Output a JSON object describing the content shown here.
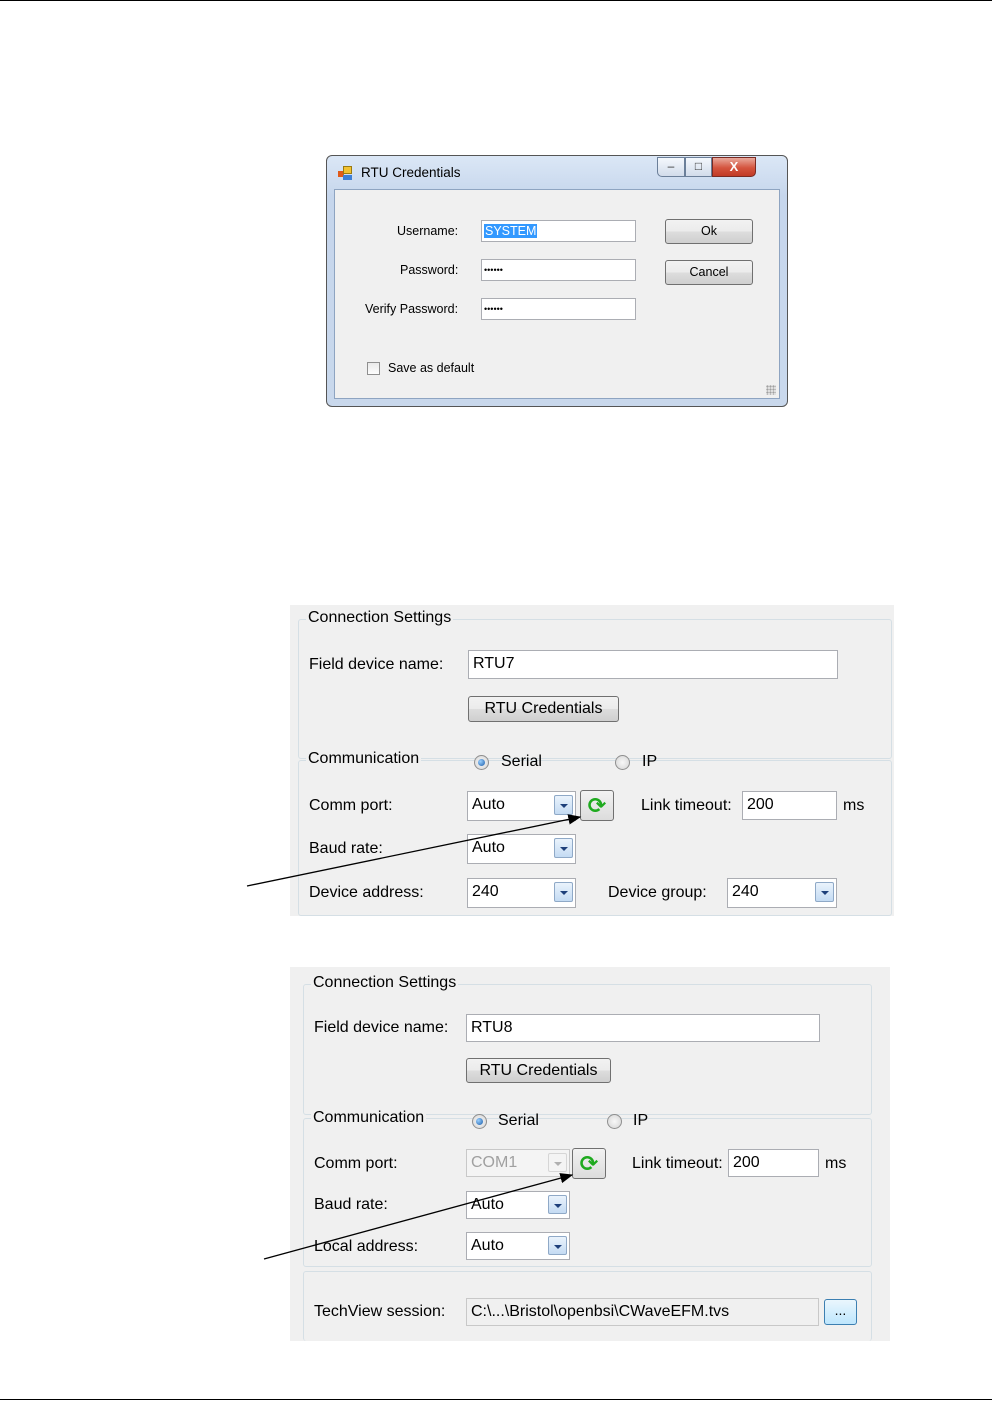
{
  "dialog": {
    "title": "RTU Credentials",
    "window_buttons": {
      "minimize": "–",
      "maximize": "□",
      "close": "X"
    },
    "username_label": "Username:",
    "username_value": "SYSTEM",
    "password_label": "Password:",
    "password_value": "••••••",
    "verify_label": "Verify Password:",
    "verify_value": "••••••",
    "ok_label": "Ok",
    "cancel_label": "Cancel",
    "save_default_label": "Save as default",
    "save_default_checked": false
  },
  "panel1": {
    "connection_legend": "Connection Settings",
    "device_name_label": "Field device name:",
    "device_name_value": "RTU7",
    "credentials_button": "RTU Credentials",
    "communication_legend": "Communication",
    "serial_label": "Serial",
    "ip_label": "IP",
    "serial_selected": true,
    "comm_port_label": "Comm port:",
    "comm_port_value": "Auto",
    "link_timeout_label": "Link timeout:",
    "link_timeout_value": "200",
    "ms_label": "ms",
    "baud_rate_label": "Baud rate:",
    "baud_rate_value": "Auto",
    "device_address_label": "Device address:",
    "device_address_value": "240",
    "device_group_label": "Device group:",
    "device_group_value": "240",
    "refresh_icon": "refresh-icon"
  },
  "panel2": {
    "connection_legend": "Connection Settings",
    "device_name_label": "Field device name:",
    "device_name_value": "RTU8",
    "credentials_button": "RTU Credentials",
    "communication_legend": "Communication",
    "serial_label": "Serial",
    "ip_label": "IP",
    "serial_selected": true,
    "comm_port_label": "Comm port:",
    "comm_port_value": "COM1",
    "link_timeout_label": "Link timeout:",
    "link_timeout_value": "200",
    "ms_label": "ms",
    "baud_rate_label": "Baud rate:",
    "baud_rate_value": "Auto",
    "local_address_label": "Local address:",
    "local_address_value": "Auto",
    "techview_label": "TechView session:",
    "techview_value": "C:\\...\\Bristol\\openbsi\\CWaveEFM.tvs",
    "browse_label": "...",
    "refresh_icon": "refresh-icon"
  },
  "colors": {
    "refresh_green": "#1faa1f",
    "selection_blue": "#3399ff",
    "close_red": "#c13a25"
  }
}
